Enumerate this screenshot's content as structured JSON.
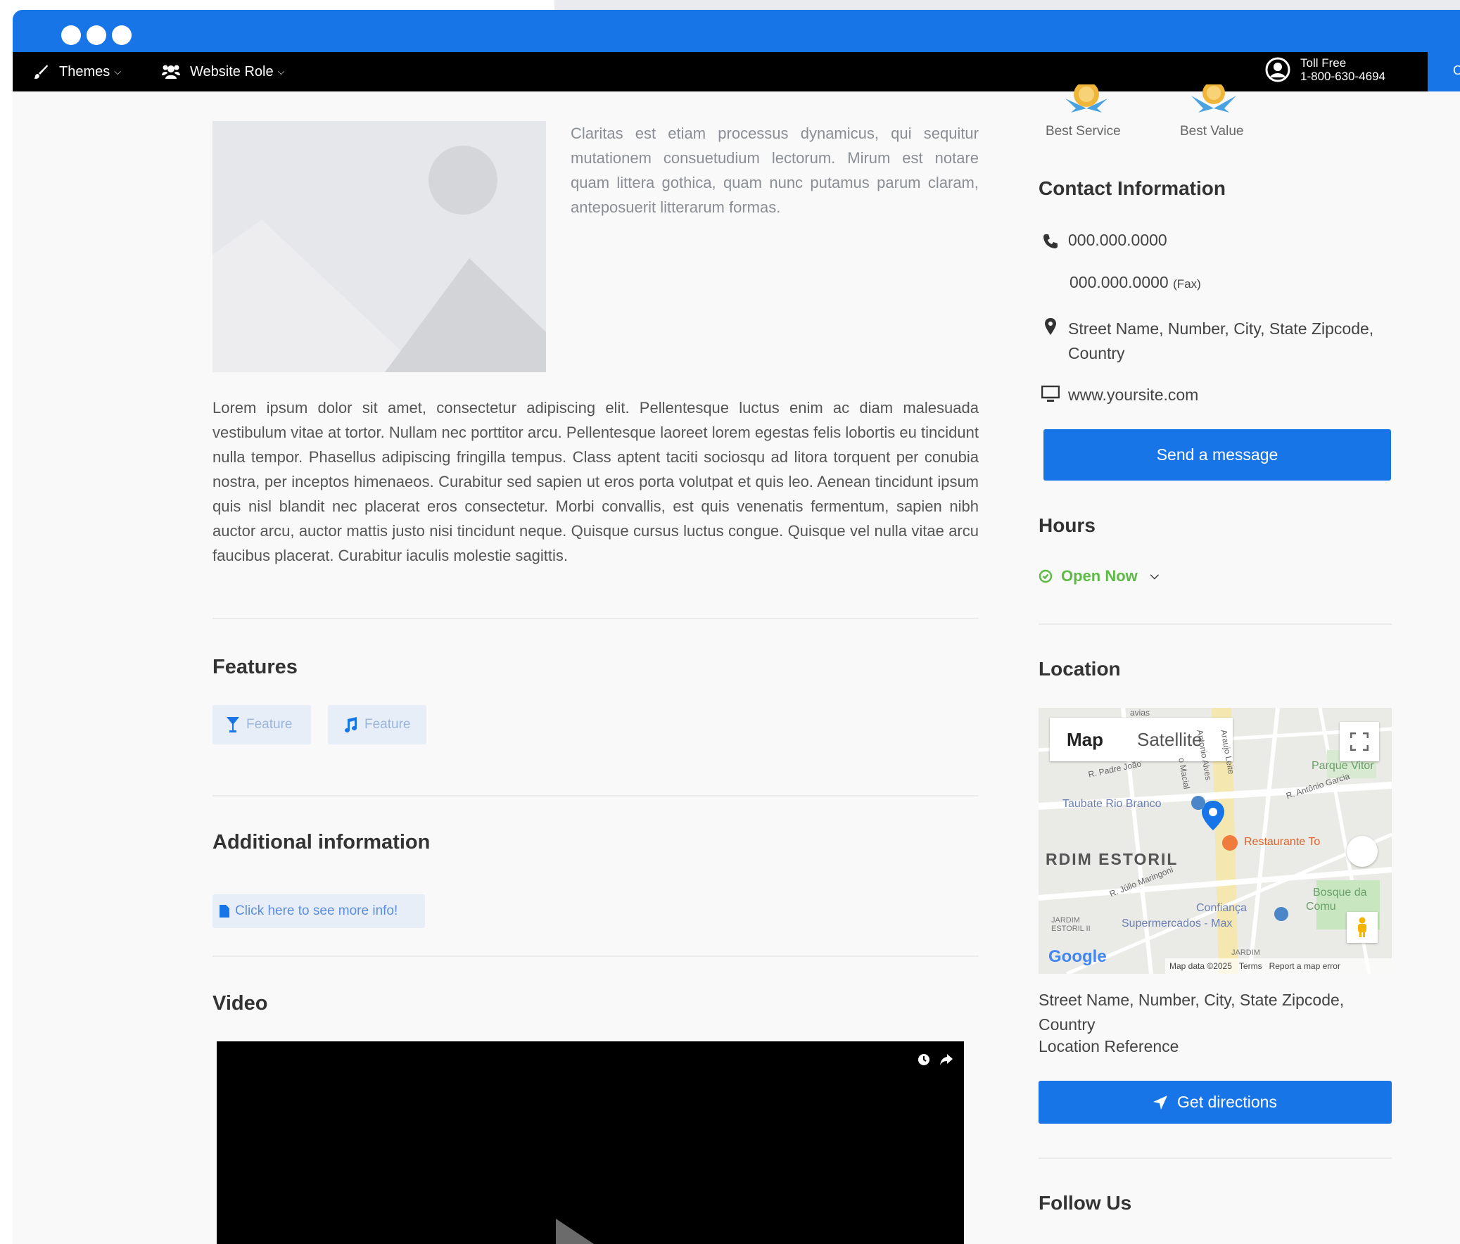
{
  "toolbar": {
    "themes_label": "Themes",
    "website_role_label": "Website Role",
    "toll_free_label": "Toll Free",
    "toll_free_number": "1-800-630-4694",
    "order_label": "Orc"
  },
  "main": {
    "intro_text": "Claritas est etiam processus dynamicus, qui sequitur mutationem consuetudium lectorum. Mirum est notare quam littera gothica, quam nunc putamus parum claram, anteposuerit litterarum formas.",
    "description": "Lorem ipsum dolor sit amet, consectetur adipiscing elit. Pellentesque luctus enim ac diam malesuada vestibulum vitae at tortor. Nullam nec porttitor arcu. Pellentesque laoreet lorem egestas felis lobortis eu tincidunt nulla tempor. Phasellus adipiscing fringilla tempus. Class aptent taciti sociosqu ad litora torquent per conubia nostra, per inceptos himenaeos. Curabitur sed sapien ut eros porta volutpat et quis leo. Aenean tincidunt ipsum quis nisl blandit nec placerat eros consectetur. Morbi convallis, est quis venenatis fermentum, sapien nibh auctor arcu, auctor mattis justo nisi tincidunt neque. Quisque cursus luctus congue. Quisque vel nulla vitae arcu faucibus placerat. Curabitur iaculis molestie sagittis.",
    "features_title": "Features",
    "features": [
      {
        "label": "Feature",
        "icon": "cocktail-icon"
      },
      {
        "label": "Feature",
        "icon": "music-icon"
      }
    ],
    "additional_title": "Additional information",
    "more_info_label": "Click here to see more info!",
    "video_title": "Video"
  },
  "sidebar": {
    "badges": [
      "Best Service",
      "Best Value"
    ],
    "contact_title": "Contact Information",
    "phone": "000.000.0000",
    "fax_number": "000.000.0000",
    "fax_label": "(Fax)",
    "address": "Street Name, Number, City, State Zipcode, Country",
    "website": "www.yoursite.com",
    "send_message_label": "Send a message",
    "hours_title": "Hours",
    "open_now_label": "Open Now",
    "location_title": "Location",
    "location_address": "Street Name, Number, City, State Zipcode, Country",
    "location_reference": "Location Reference",
    "directions_label": "Get directions",
    "follow_title": "Follow Us"
  },
  "map": {
    "map_tab": "Map",
    "satellite_tab": "Satellite",
    "labels": {
      "jardim_estoril": "RDIM ESTORIL",
      "taubate": "Taubate Rio Branco",
      "restaurante": "Restaurante To",
      "parque": "Parque Vitor",
      "bosque": "Bosque da",
      "bosque2": "Comu",
      "confianca": "Confiança",
      "supermercados": "Supermercados - Max",
      "padre_joao": "R. Padre João",
      "antonio_garcia": "R. Antônio Garcia",
      "julio": "R. Júlio Maringoni",
      "jardim_small": "JARDIM ESTORIL II",
      "jardim2": "JARDIM",
      "antonio_alves": "Antonio Alves",
      "araujo": "Araujo Leite",
      "macial": "o Macial",
      "colina": "avias"
    },
    "google": "Google",
    "map_data": "Map data ©2025",
    "terms": "Terms",
    "report": "Report a map error"
  },
  "colors": {
    "primary": "#1775e8",
    "open_green": "#5dbb46",
    "toolbar_bg": "#000000"
  }
}
